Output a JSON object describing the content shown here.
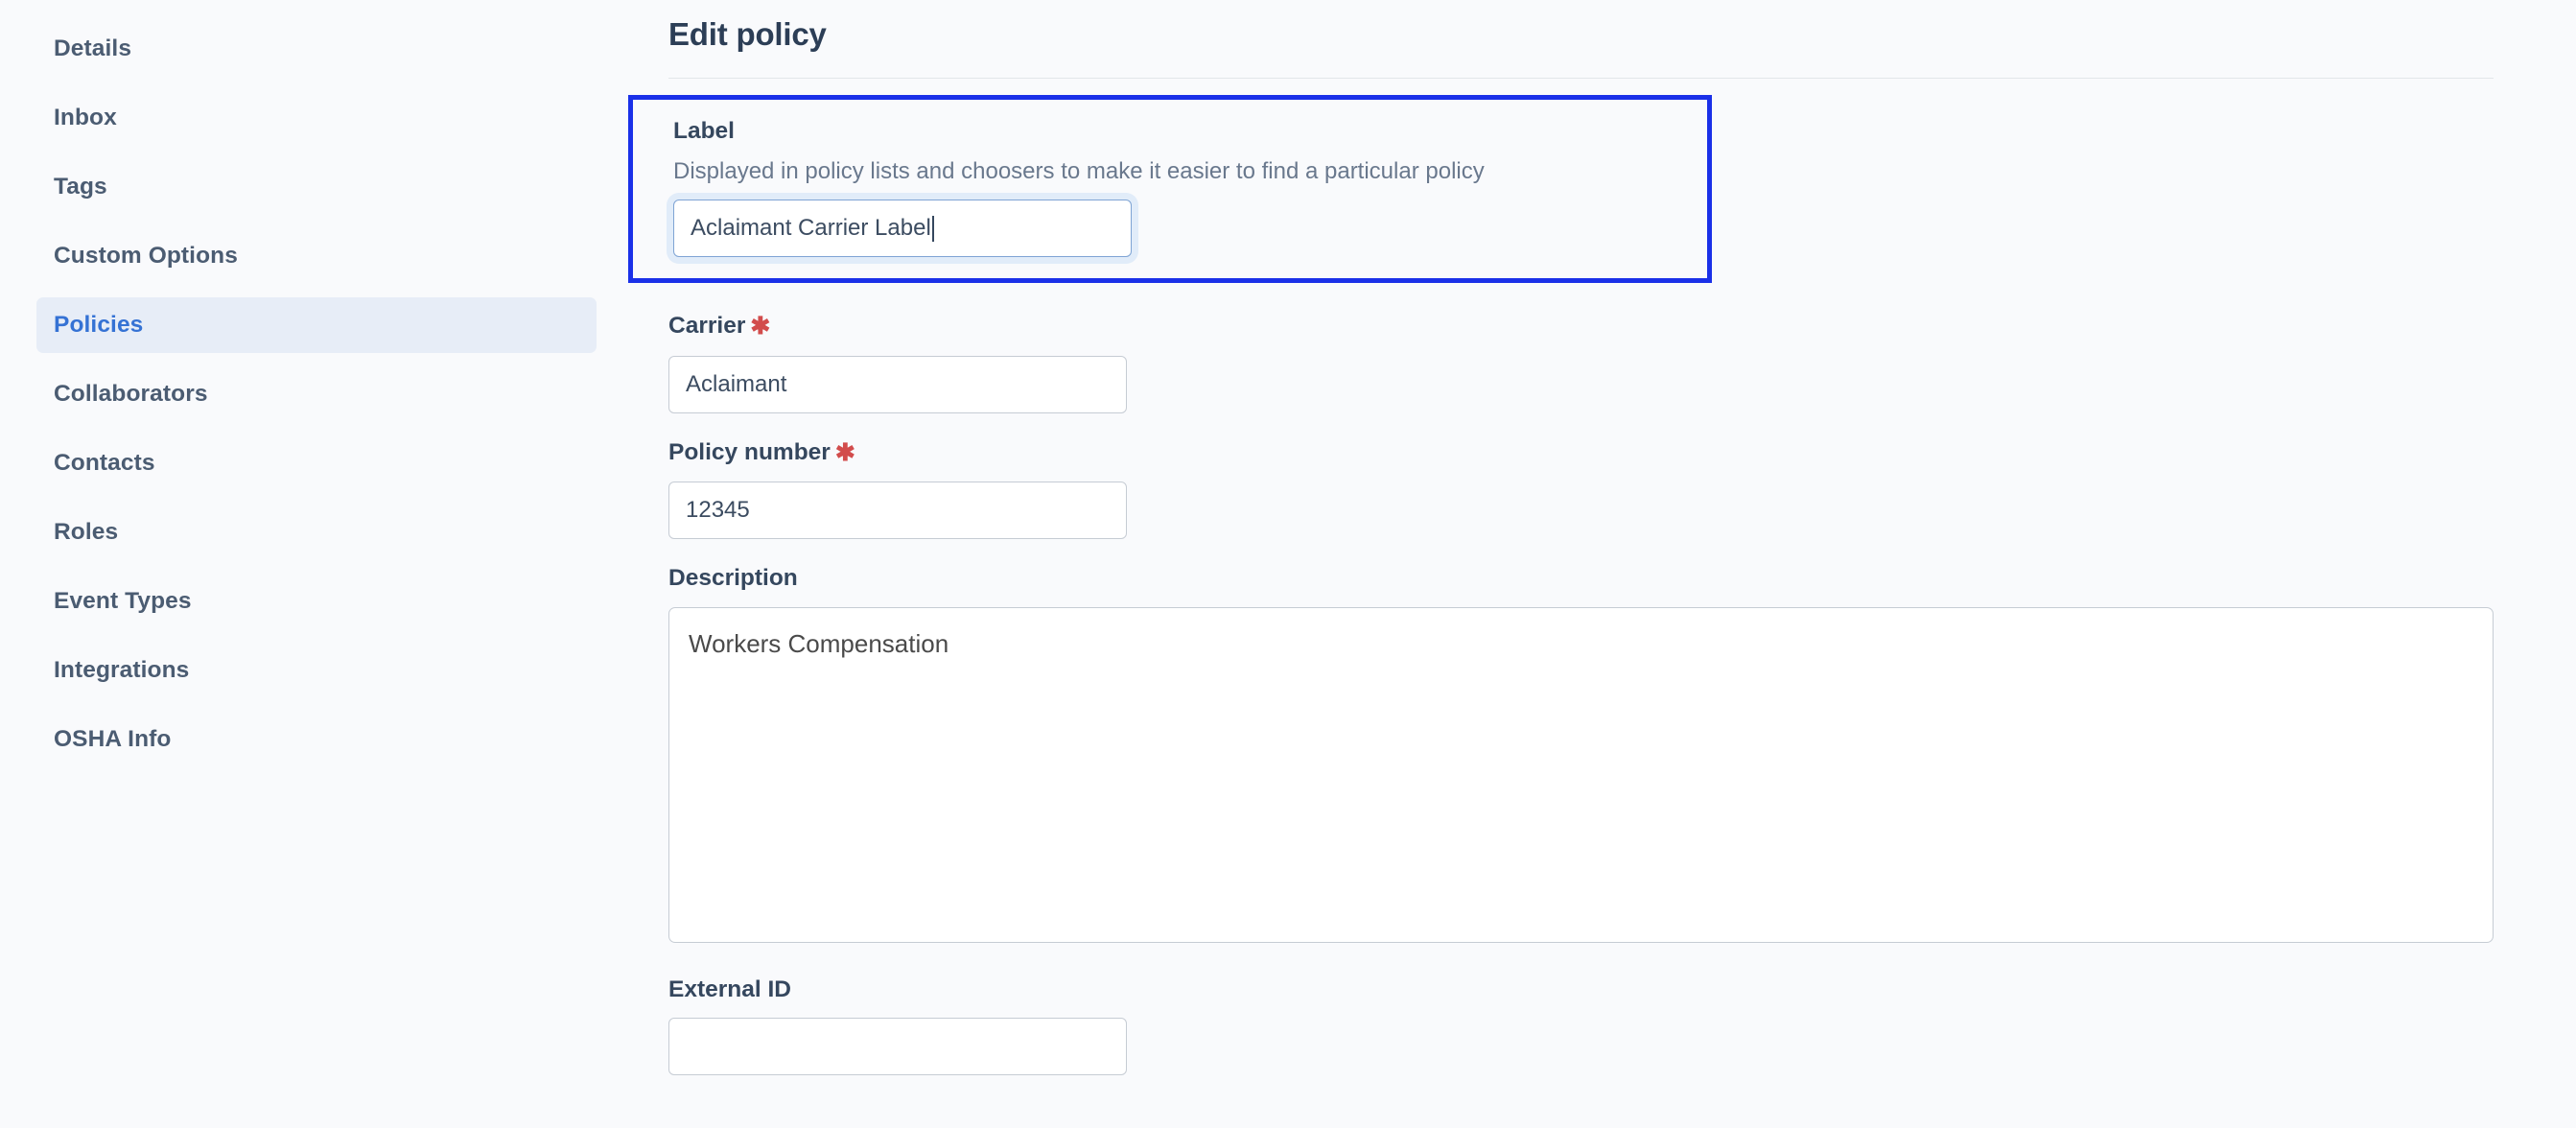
{
  "sidebar": {
    "items": [
      {
        "label": "Details",
        "active": false
      },
      {
        "label": "Inbox",
        "active": false
      },
      {
        "label": "Tags",
        "active": false
      },
      {
        "label": "Custom Options",
        "active": false
      },
      {
        "label": "Policies",
        "active": true
      },
      {
        "label": "Collaborators",
        "active": false
      },
      {
        "label": "Contacts",
        "active": false
      },
      {
        "label": "Roles",
        "active": false
      },
      {
        "label": "Event Types",
        "active": false
      },
      {
        "label": "Integrations",
        "active": false
      },
      {
        "label": "OSHA Info",
        "active": false
      }
    ]
  },
  "header": {
    "title": "Edit policy"
  },
  "form": {
    "label_field": {
      "label": "Label",
      "help": "Displayed in policy lists and choosers to make it easier to find a particular policy",
      "value": "Aclaimant Carrier Label",
      "placeholder": "",
      "focused": true,
      "required": false
    },
    "carrier_field": {
      "label": "Carrier",
      "required_marker": "✱",
      "value": "Aclaimant",
      "placeholder": "",
      "required": true
    },
    "policy_number_field": {
      "label": "Policy number",
      "required_marker": "✱",
      "value": "12345",
      "placeholder": "",
      "required": true
    },
    "description_field": {
      "label": "Description",
      "value": "Workers Compensation",
      "placeholder": "",
      "required": false
    },
    "external_id_field": {
      "label": "External ID",
      "value": "",
      "placeholder": "",
      "required": false
    }
  },
  "colors": {
    "page_background": "#f9fafc",
    "text_primary": "#35475e",
    "text_help": "#69788d",
    "accent_blue": "#3572d4",
    "active_nav_background": "#e7edf7",
    "highlight_border": "#1a30e8",
    "required_asterisk": "#d24c4c",
    "input_border": "#c6ccd4",
    "input_focus_border": "#7fa4d4",
    "input_focus_ring": "#e1ecf9",
    "divider": "#e3e6ea"
  }
}
